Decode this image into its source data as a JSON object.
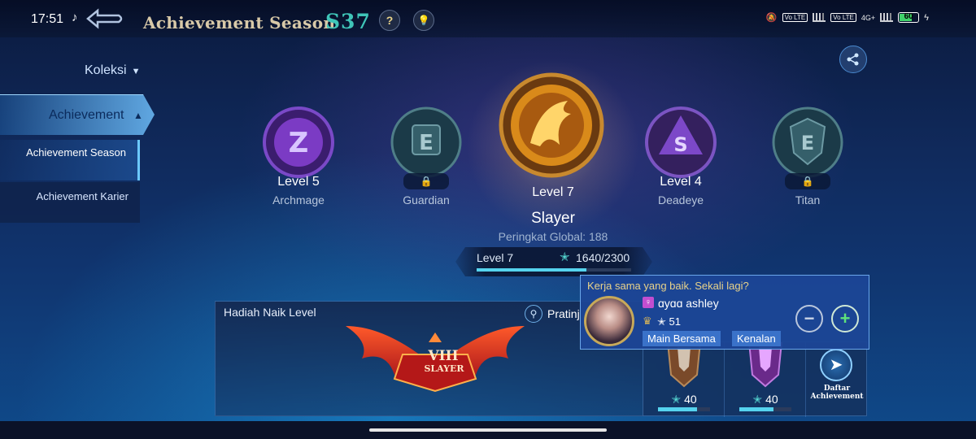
{
  "status": {
    "time": "17:51",
    "tiktok": "♪",
    "dots": "···",
    "battery": "60",
    "network": "4G+",
    "volte1": "Vo LTE",
    "volte2": "Vo LTE"
  },
  "header": {
    "title": "Achievement Season",
    "season": "S37",
    "help": "?",
    "hint": "💡"
  },
  "sidebar": {
    "koleksi": "Koleksi",
    "achievement": "Achievement",
    "season": "Achievement Season",
    "karier": "Achievement Karier"
  },
  "emblems": [
    {
      "level": "Level 5",
      "name": "Archmage",
      "color": "#8a3ed2",
      "letter": "Z"
    },
    {
      "level": "",
      "name": "Guardian",
      "color": "#5a8a94",
      "letter": "E",
      "locked": true
    },
    {
      "level": "Level 4",
      "name": "Deadeye",
      "color": "#7d4ad0",
      "letter": "S"
    },
    {
      "level": "",
      "name": "Titan",
      "color": "#4a8a92",
      "letter": "E",
      "locked": true
    }
  ],
  "current": {
    "level": "Level 7",
    "name": "Slayer",
    "rank": "Peringkat Global: 188",
    "points": 1640,
    "points_text": "1640/2300",
    "points_max": 2300
  },
  "reward": {
    "title": "Hadiah Naik Level",
    "preview": "Pratinj",
    "tier": "VIII",
    "tier_name": "SLAYER"
  },
  "cards": [
    {
      "points": "40",
      "progress": 0.75
    },
    {
      "points": "40",
      "progress": 0.65
    }
  ],
  "daftar": "Daftar Achievement",
  "popup": {
    "message": "Kerja sama yang baik. Sekali lagi?",
    "username": "ɑyɑɑ ashley",
    "stars": "51",
    "btn1": "Main Bersama",
    "btn2": "Kenalan",
    "minus": "−",
    "plus": "+"
  }
}
